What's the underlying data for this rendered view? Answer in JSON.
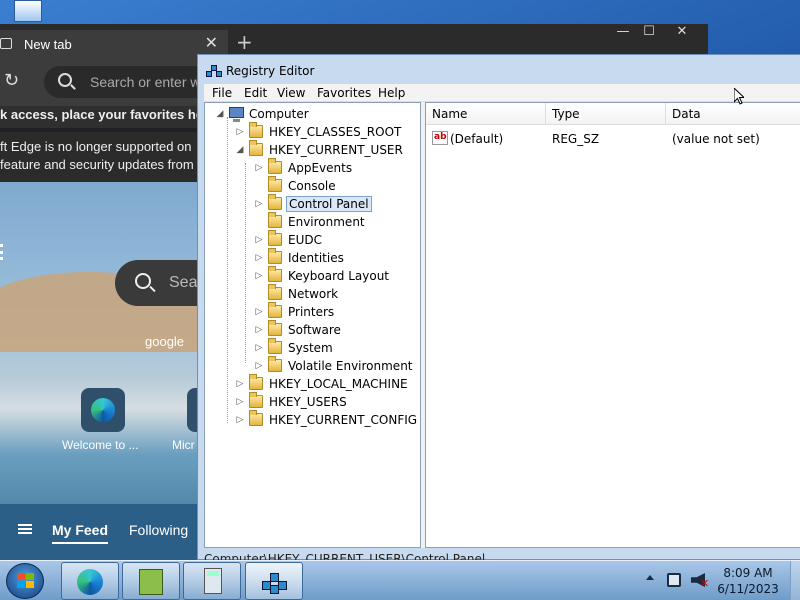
{
  "edge": {
    "tab_title": "New tab",
    "tab_close": "✕",
    "new_tab": "+",
    "minimize": "—",
    "maximize": "☐",
    "close": "✕",
    "refresh": "↻",
    "address_placeholder": "Search or enter w",
    "favorites_bar": "k access, place your favorites here o",
    "notice_line1": "ft Edge is no longer supported on",
    "notice_line2": "feature and security updates from",
    "search_placeholder": "Sea",
    "search_engine": "google",
    "tiles": [
      {
        "label": "Welcome to ..."
      },
      {
        "label": "Micr"
      }
    ],
    "feed": {
      "my_feed": "My Feed",
      "following": "Following"
    }
  },
  "regedit": {
    "title": "Registry Editor",
    "menu": [
      "File",
      "Edit",
      "View",
      "Favorites",
      "Help"
    ],
    "tree": {
      "root": "Computer",
      "hives": [
        "HKEY_CLASSES_ROOT",
        "HKEY_CURRENT_USER",
        "HKEY_LOCAL_MACHINE",
        "HKEY_USERS",
        "HKEY_CURRENT_CONFIG"
      ],
      "current_user_children": [
        "AppEvents",
        "Console",
        "Control Panel",
        "Environment",
        "EUDC",
        "Identities",
        "Keyboard Layout",
        "Network",
        "Printers",
        "Software",
        "System",
        "Volatile Environment"
      ],
      "selected": "Control Panel"
    },
    "columns": {
      "name": "Name",
      "type": "Type",
      "data": "Data"
    },
    "values": [
      {
        "name": "(Default)",
        "type": "REG_SZ",
        "data": "(value not set)"
      }
    ],
    "status": "Computer\\HKEY_CURRENT_USER\\Control Panel"
  },
  "taskbar": {
    "time": "8:09 AM",
    "date": "6/11/2023"
  },
  "colors": {
    "desktop": "#1f5aa8",
    "taskbar": "#8fb4da",
    "selection": "#dbe8f7"
  }
}
